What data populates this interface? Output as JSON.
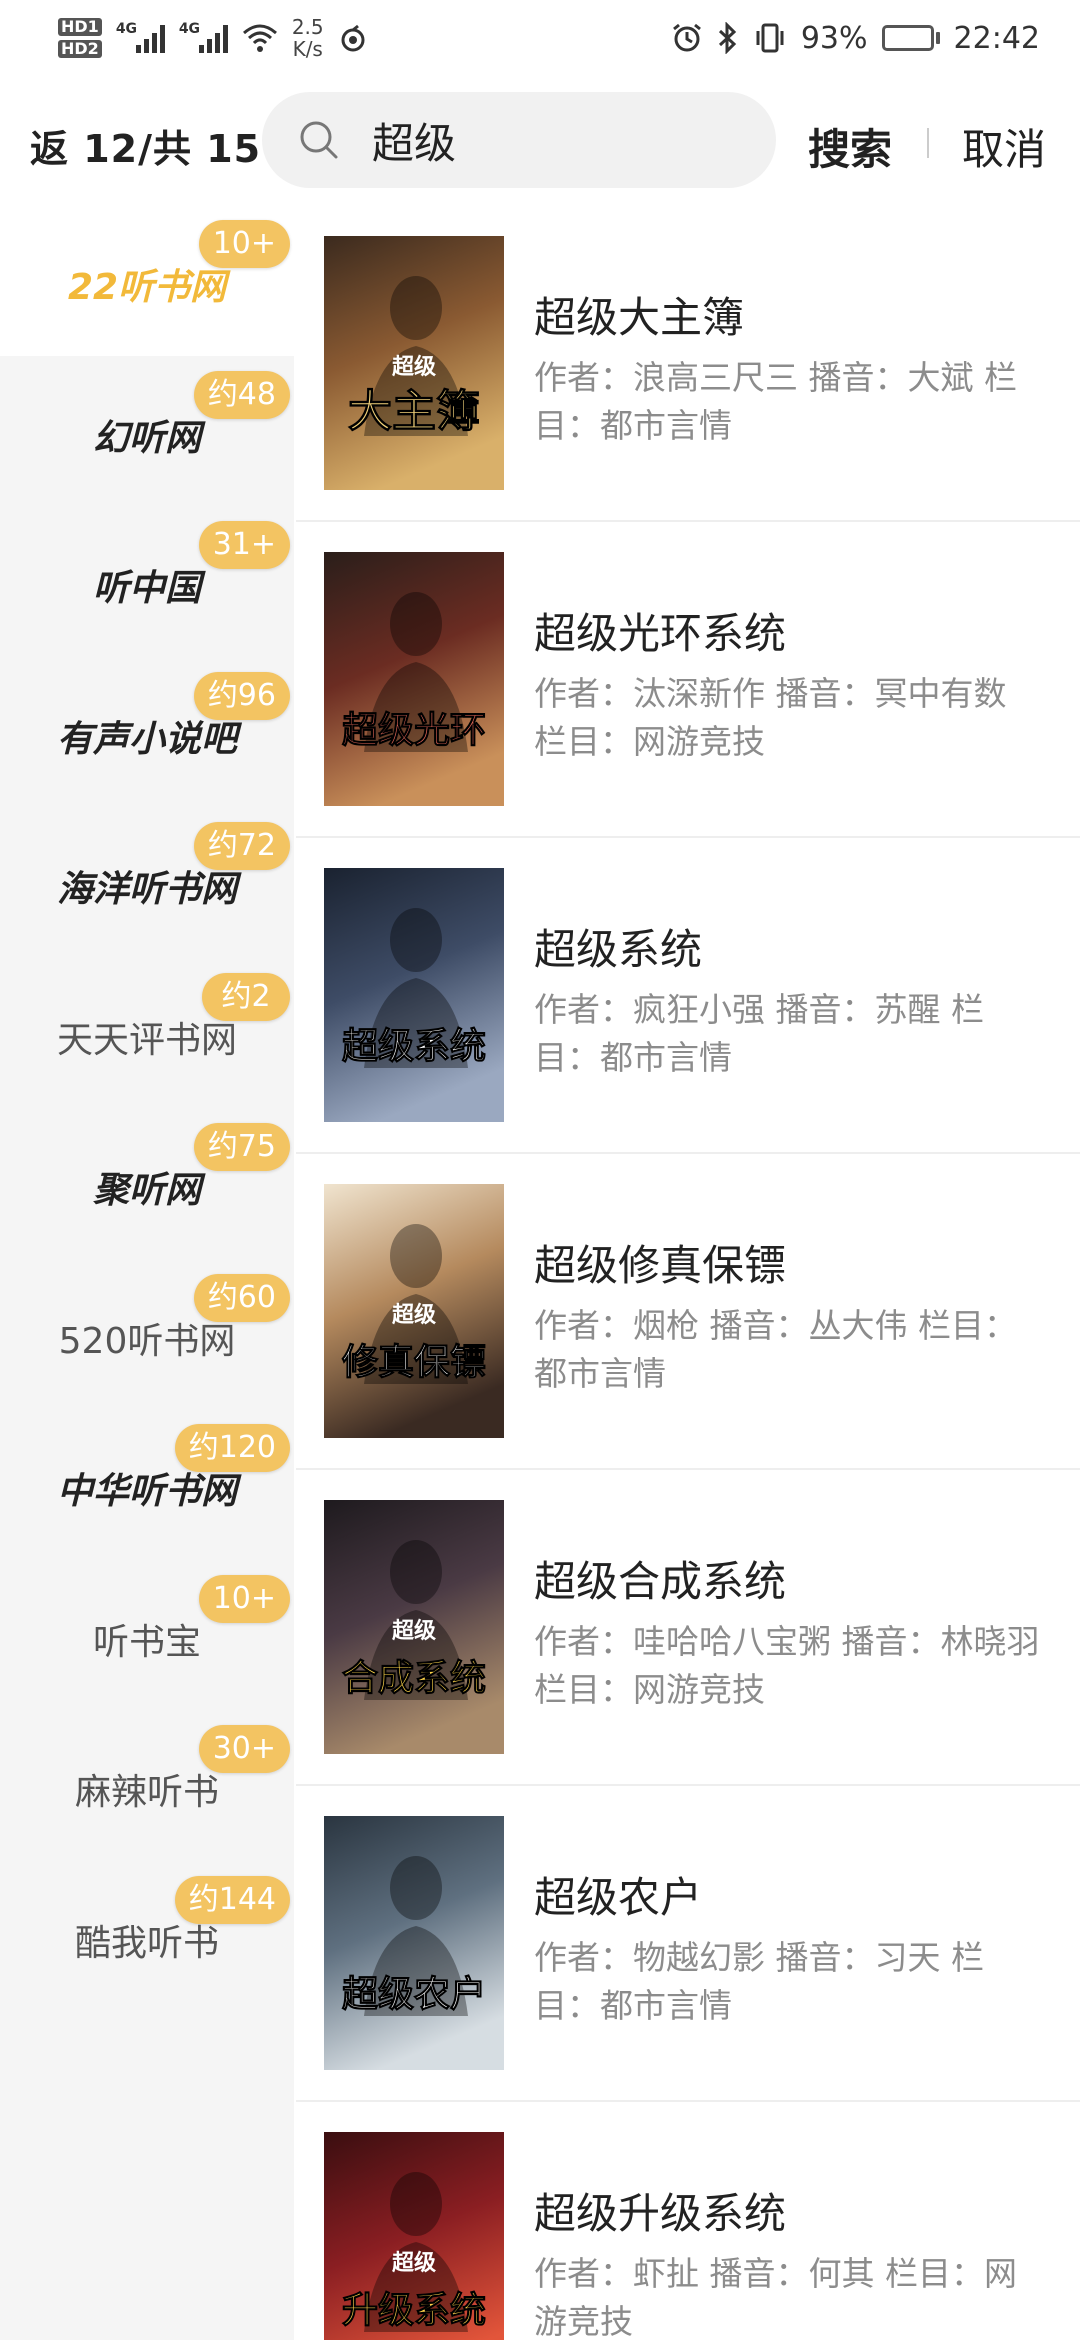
{
  "status_bar": {
    "hd1": "HD",
    "hd1_sub": "1",
    "hd2": "HD",
    "hd2_sub": "2",
    "net1": "4G",
    "net2": "4G",
    "speed_value": "2.5",
    "speed_unit": "K/s",
    "battery": "93%",
    "battery_level": 0.93,
    "time": "22:42"
  },
  "header": {
    "back_label": "返 12/共 15",
    "search_value": "超级",
    "search_button": "搜索",
    "cancel_button": "取消"
  },
  "sources": [
    {
      "name": "22听书网",
      "badge": "10+",
      "active": true,
      "style": "bold"
    },
    {
      "name": "幻听网",
      "badge": "约48",
      "active": false,
      "style": "bold"
    },
    {
      "name": "听中国",
      "badge": "31+",
      "active": false,
      "style": "bold"
    },
    {
      "name": "有声小说吧",
      "badge": "约96",
      "active": false,
      "style": "bold"
    },
    {
      "name": "海洋听书网",
      "badge": "约72",
      "active": false,
      "style": "bold"
    },
    {
      "name": "天天评书网",
      "badge": "约2",
      "active": false,
      "style": "normal"
    },
    {
      "name": "聚听网",
      "badge": "约75",
      "active": false,
      "style": "bold"
    },
    {
      "name": "520听书网",
      "badge": "约60",
      "active": false,
      "style": "normal"
    },
    {
      "name": "中华听书网",
      "badge": "约120",
      "active": false,
      "style": "bold"
    },
    {
      "name": "听书宝",
      "badge": "10+",
      "active": false,
      "style": "normal"
    },
    {
      "name": "麻辣听书",
      "badge": "30+",
      "active": false,
      "style": "normal"
    },
    {
      "name": "酷我听书",
      "badge": "约144",
      "active": false,
      "style": "normal"
    }
  ],
  "books": [
    {
      "title": "超级大主簿",
      "meta": "作者：浪高三尺三  播音：大斌 栏目：都市言情",
      "cover_text": "大主簿",
      "cover_top": "超级",
      "cover_colors": [
        "#3b2a1e",
        "#8a5a32",
        "#d9b06a"
      ],
      "cover_text_color": "#f3d37a"
    },
    {
      "title": "超级光环系统",
      "meta": "作者：汰深新作  播音：冥中有数 栏目：网游竞技",
      "cover_text": "超级光环",
      "cover_top": "",
      "cover_colors": [
        "#2a1e1a",
        "#6b2c22",
        "#c9905a"
      ],
      "cover_text_color": "#e86a5a"
    },
    {
      "title": "超级系统",
      "meta": "作者：疯狂小强  播音：苏醒 栏目：都市言情",
      "cover_text": "超级系统",
      "cover_top": "",
      "cover_colors": [
        "#1a2230",
        "#3e4c66",
        "#9aa8c0"
      ],
      "cover_text_color": "#ffffff"
    },
    {
      "title": "超级修真保镖",
      "meta": "作者：烟枪  播音：丛大伟 栏目：都市言情",
      "cover_text": "修真保镖",
      "cover_top": "超级",
      "cover_colors": [
        "#f0e4cf",
        "#b58a5e",
        "#3a2a22"
      ],
      "cover_text_color": "#ffffff"
    },
    {
      "title": "超级合成系统",
      "meta": "作者：哇哈哈八宝粥  播音：林晓羽 栏目：网游竞技",
      "cover_text": "合成系统",
      "cover_top": "超级",
      "cover_colors": [
        "#1e1a1e",
        "#4a3a44",
        "#a88a6a"
      ],
      "cover_text_color": "#ffd64a"
    },
    {
      "title": "超级农户",
      "meta": "作者：物越幻影  播音：习天 栏目：都市言情",
      "cover_text": "超级农户",
      "cover_top": "",
      "cover_colors": [
        "#2a3540",
        "#5f7080",
        "#d6dde2"
      ],
      "cover_text_color": "#ffffff"
    },
    {
      "title": "超级升级系统",
      "meta": "作者：虾扯  播音：何其 栏目：网游竞技",
      "cover_text": "升级系统",
      "cover_top": "超级",
      "cover_colors": [
        "#3a0e10",
        "#8a1e22",
        "#e2553a"
      ],
      "cover_text_color": "#ffd24a"
    }
  ]
}
